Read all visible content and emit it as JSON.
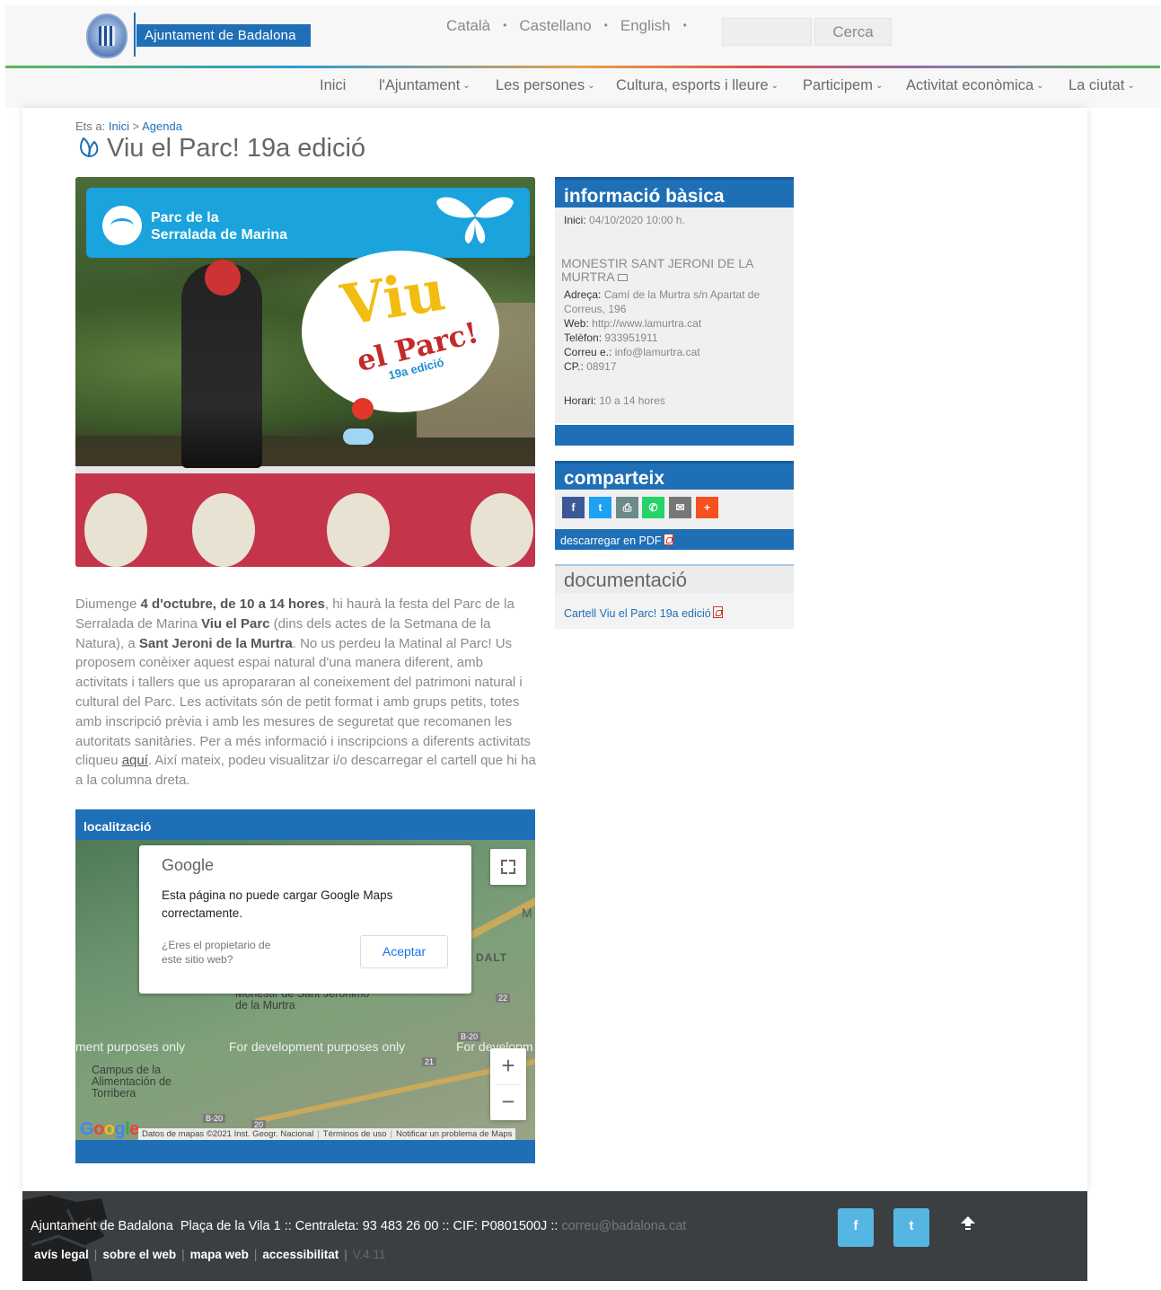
{
  "header": {
    "logo_text": "Ajuntament de Badalona",
    "languages": [
      "Català",
      "Castellano",
      "English"
    ],
    "language_separator": "•",
    "search": {
      "placeholder": "",
      "button_label": "Cerca"
    }
  },
  "nav": {
    "items": [
      {
        "label": "Inici",
        "has_dropdown": false
      },
      {
        "label": "l'Ajuntament",
        "has_dropdown": true
      },
      {
        "label": "Les persones",
        "has_dropdown": true
      },
      {
        "label": "Cultura, esports i lleure",
        "has_dropdown": true
      },
      {
        "label": "Participem",
        "has_dropdown": true
      },
      {
        "label": "Activitat econòmica",
        "has_dropdown": true
      },
      {
        "label": "La ciutat",
        "has_dropdown": true
      }
    ],
    "dropdown_icon": "chevron-down-icon"
  },
  "breadcrumb": {
    "prefix": "Ets a:",
    "links": [
      "Inici",
      "Agenda"
    ],
    "separator": ">"
  },
  "page": {
    "title": "Viu el Parc! 19a edició",
    "title_icon": "leaf-icon"
  },
  "poster": {
    "park_line1": "Parc de la",
    "park_line2": "Serralada de Marina",
    "headline": "Viu",
    "subheadline": "el Parc!",
    "edition": "19a edició",
    "butterfly_icon": "butterfly-icon"
  },
  "description": {
    "p1": "Diumenge ",
    "date_bold": "4 d'octubre, de 10 a 14 hores",
    "p2": ", hi haurà la festa del Parc de la Serralada de Marina ",
    "event_bold": "Viu el Parc",
    "p3": " (dins dels actes de la Setmana de la Natura), a ",
    "place_bold": "Sant Jeroni de la Murtra",
    "p4": ". No us perdeu la Matinal al Parc! Us proposem conèixer aquest espai natural d'una manera diferent, amb activitats i tallers que us apropararan al coneixement del patrimoni natural i cultural del Parc. Les activitats són de petit format i amb grups petits, totes amb inscripció prèvia i amb les mesures de seguretat que recomanen les autoritats sanitàries. Per a més informació i inscripcions a diferents activitats cliqueu ",
    "link": "aquí",
    "p5": ". Així mateix, podeu visualitzar i/o descarregar el cartell que hi ha a la columna dreta."
  },
  "map": {
    "header": "localització",
    "dialog": {
      "brand": "Google",
      "message": "Esta página no puede cargar Google Maps correctamente.",
      "owner_question": "¿Eres el propietario de este sitio web?",
      "accept_label": "Aceptar"
    },
    "watermark_left": "ment purposes only",
    "watermark_mid": "For development purposes only",
    "watermark_right": "For developm",
    "places": {
      "monastery": "Monestir de Sant Jerónimo de la Murtra",
      "campus": "Campus de la Alimentación de Torribera",
      "dalt": "DALT",
      "m": "M"
    },
    "road_labels": [
      "22",
      "B-20",
      "21",
      "B-20",
      "20"
    ],
    "zoom_in": "+",
    "zoom_out": "−",
    "google_logo": "Google",
    "attribution": [
      "Datos de mapas ©2021 Inst. Geogr. Nacional",
      "Términos de uso",
      "Notificar un problema de Maps"
    ]
  },
  "info": {
    "header": "informació bàsica",
    "start_label": "Inici:",
    "start_value": "04/10/2020 10:00 h.",
    "venue": "MONESTIR SANT JERONI DE LA MURTRA",
    "address_label": "Adreça:",
    "address_line1": "Camí de la Murtra s/n Apartat de",
    "address_line2": "Correus, 196",
    "web_label": "Web:",
    "web_value": "http://www.lamurtra.cat",
    "phone_label": "Telèfon:",
    "phone_value": "933951911",
    "email_label": "Correu e.:",
    "email_value": "info@lamurtra.cat",
    "cp_label": "CP.:",
    "cp_value": "08917",
    "schedule_label": "Horari:",
    "schedule_value": "10 a 14 hores"
  },
  "share": {
    "header": "comparteix",
    "buttons": [
      {
        "name": "facebook",
        "glyph": "f",
        "color": "#3b5998"
      },
      {
        "name": "twitter",
        "glyph": "t",
        "color": "#1da1f2"
      },
      {
        "name": "print",
        "glyph": "⎙",
        "color": "#6d8a8a"
      },
      {
        "name": "whatsapp",
        "glyph": "✆",
        "color": "#25d366"
      },
      {
        "name": "email",
        "glyph": "✉",
        "color": "#777777"
      },
      {
        "name": "more",
        "glyph": "+",
        "color": "#f4511e"
      }
    ],
    "pdf_label": "descarregar en PDF"
  },
  "documents": {
    "header": "documentació",
    "items": [
      "Cartell Viu el Parc! 19a edició"
    ]
  },
  "footer": {
    "org": "Ajuntament de Badalona",
    "address": "Plaça de la Vila 1 :: Centraleta: 93 483 26 00 :: CIF: P0801500J ::",
    "email": "correu@badalona.cat",
    "links": [
      "avís legal",
      "sobre el web",
      "mapa web",
      "accessibilitat"
    ],
    "version": "V.4.11",
    "social": [
      {
        "name": "facebook",
        "glyph": "f"
      },
      {
        "name": "twitter",
        "glyph": "t"
      }
    ]
  },
  "colors": {
    "brand_blue": "#1f6fb7",
    "footer_bg": "#3c3f41",
    "social_blue": "#56b6e3"
  }
}
